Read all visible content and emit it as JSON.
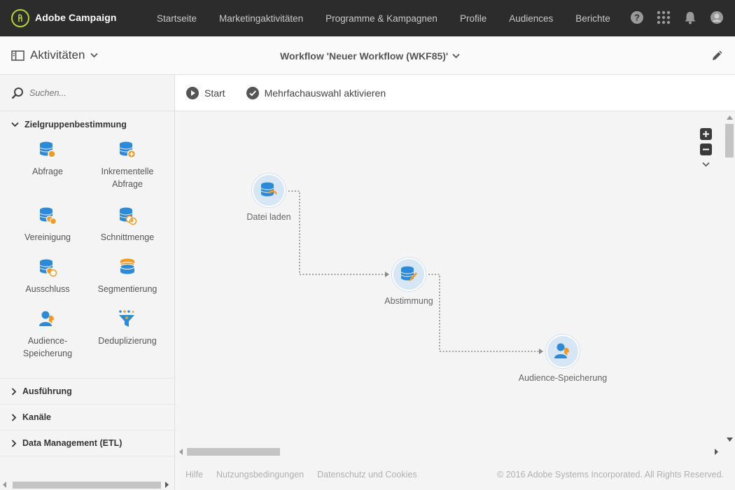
{
  "app": {
    "brand": "Adobe Campaign"
  },
  "nav": {
    "items": [
      "Startseite",
      "Marketingaktivitäten",
      "Programme & Kampagnen",
      "Profile",
      "Audiences",
      "Berichte"
    ]
  },
  "header": {
    "activities_label": "Aktivitäten",
    "workflow_title": "Workflow 'Neuer Workflow (WKF85)'"
  },
  "sidebar": {
    "search_placeholder": "Suchen...",
    "sections": {
      "targeting": "Zielgruppenbestimmung",
      "execution": "Ausführung",
      "channels": "Kanäle",
      "data_management": "Data Management (ETL)"
    },
    "activities": [
      {
        "label": "Abfrage",
        "icon": "query-icon"
      },
      {
        "label": "Inkrementelle Abfrage",
        "icon": "incremental-query-icon"
      },
      {
        "label": "Vereinigung",
        "icon": "union-icon"
      },
      {
        "label": "Schnittmenge",
        "icon": "intersection-icon"
      },
      {
        "label": "Ausschluss",
        "icon": "exclusion-icon"
      },
      {
        "label": "Segmentierung",
        "icon": "segmentation-icon"
      },
      {
        "label": "Audience-Speicherung",
        "icon": "save-audience-icon"
      },
      {
        "label": "Deduplizierung",
        "icon": "deduplication-icon"
      }
    ]
  },
  "toolbar": {
    "start_label": "Start",
    "multiselect_label": "Mehrfachauswahl aktivieren"
  },
  "workflow": {
    "nodes": [
      {
        "label": "Datei laden",
        "icon": "load-file-icon"
      },
      {
        "label": "Abstimmung",
        "icon": "reconciliation-icon"
      },
      {
        "label": "Audience-Speicherung",
        "icon": "save-audience-icon"
      }
    ]
  },
  "footer": {
    "help": "Hilfe",
    "terms": "Nutzungsbedingungen",
    "privacy": "Datenschutz und Cookies",
    "copyright": "© 2016 Adobe Systems Incorporated. All Rights Reserved."
  },
  "colors": {
    "topbar": "#2c2c2c",
    "accent_blue": "#2d8ad8",
    "accent_orange": "#f29a23",
    "logo_green": "#b6d334"
  }
}
